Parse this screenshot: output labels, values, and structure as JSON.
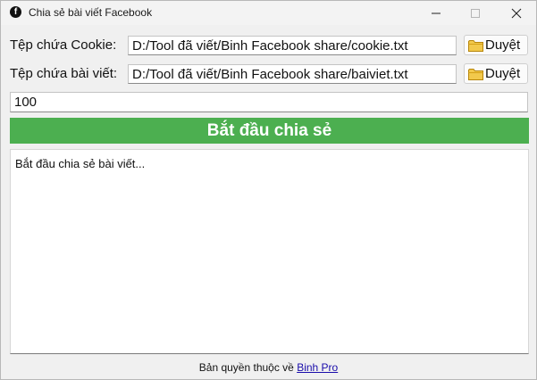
{
  "window": {
    "title": "Chia sẻ bài viết Facebook",
    "icon": "facebook-icon"
  },
  "cookie_row": {
    "label": "Tệp chứa Cookie:",
    "value": "D:/Tool đã viết/Binh Facebook share/cookie.txt",
    "browse_label": "Duyệt"
  },
  "post_row": {
    "label": "Tệp chứa bài viết:",
    "value": "D:/Tool đã viết/Binh Facebook share/baiviet.txt",
    "browse_label": "Duyệt"
  },
  "count_input": {
    "value": "100"
  },
  "start_button": {
    "label": "Bắt đầu chia sẻ",
    "color": "#4caf50"
  },
  "log": {
    "text": "Bắt đầu chia sẻ bài viết..."
  },
  "footer": {
    "prefix": "Bản quyền thuộc về",
    "link_text": "Binh Pro"
  }
}
